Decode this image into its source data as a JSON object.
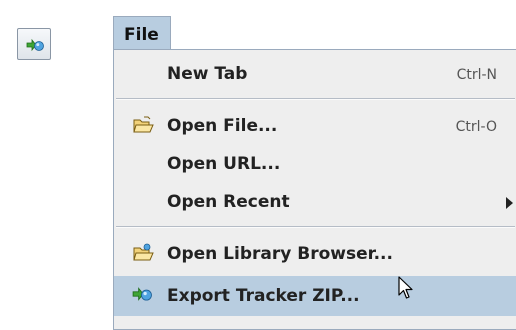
{
  "toolbar": {
    "export_icon": "export-tracker-icon"
  },
  "menu": {
    "title": "File",
    "items": [
      {
        "label": "New Tab",
        "shortcut": "Ctrl-N"
      },
      {
        "label": "Open File...",
        "shortcut": "Ctrl-O",
        "icon": "open-folder-icon"
      },
      {
        "label": "Open URL..."
      },
      {
        "label": "Open Recent",
        "submenu": true
      },
      {
        "label": "Open Library Browser...",
        "icon": "library-folder-icon"
      },
      {
        "label": "Export Tracker ZIP...",
        "icon": "export-tracker-icon",
        "selected": true
      }
    ]
  },
  "colors": {
    "selection": "#b8cde0",
    "menu_background": "#eeeeee"
  }
}
